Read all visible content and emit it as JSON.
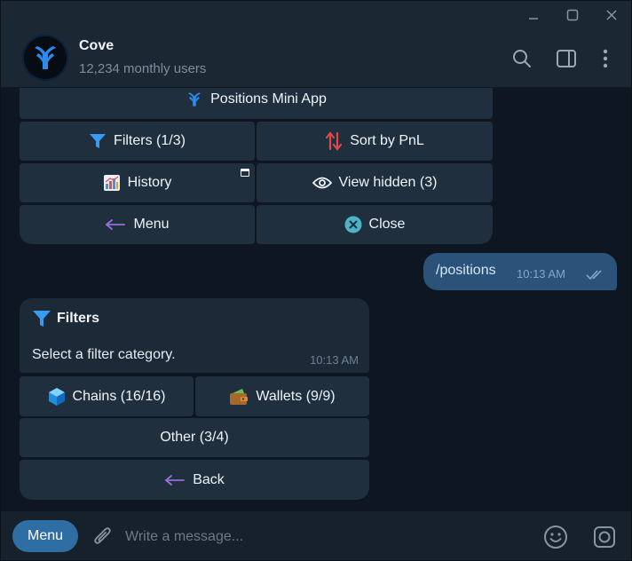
{
  "header": {
    "title": "Cove",
    "subtitle": "12,234 monthly users"
  },
  "top_keyboard": {
    "mini_app": "Positions Mini App",
    "filters": "Filters (1/3)",
    "sort": "Sort by PnL",
    "history": "History",
    "view_hidden": "View hidden (3)",
    "menu": "Menu",
    "close": "Close"
  },
  "outgoing": {
    "text": "/positions",
    "time": "10:13 AM"
  },
  "incoming": {
    "title": "Filters",
    "text": "Select a filter category.",
    "time": "10:13 AM"
  },
  "filter_keyboard": {
    "chains": "Chains (16/16)",
    "wallets": "Wallets (9/9)",
    "other": "Other (3/4)",
    "back": "Back"
  },
  "composer": {
    "menu_label": "Menu",
    "placeholder": "Write a message..."
  },
  "colors": {
    "accent": "#2f6ea5",
    "outgoing_bubble": "#2b5278",
    "button_bg": "#1f2f3e"
  }
}
